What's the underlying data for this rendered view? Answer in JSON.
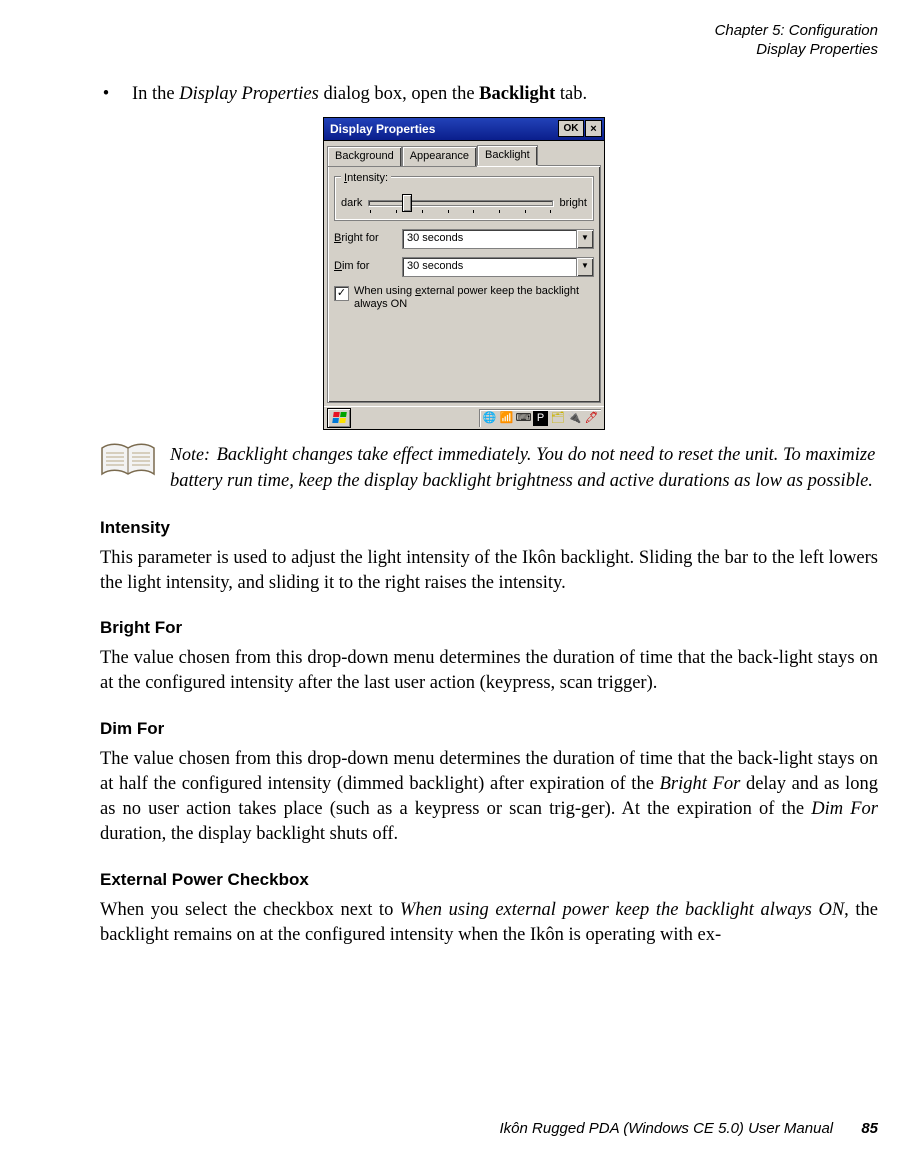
{
  "header": {
    "line1": "Chapter 5: Configuration",
    "line2": "Display Properties"
  },
  "bullet": {
    "pre": "In the ",
    "em": "Display Properties",
    "mid": " dialog box, open the ",
    "bold": "Backlight",
    "post": " tab."
  },
  "dialog": {
    "title": "Display Properties",
    "ok": "OK",
    "close": "×",
    "tabs": [
      "Background",
      "Appearance",
      "Backlight"
    ],
    "intensity_label": "Intensity:",
    "intensity_accel": "I",
    "dark": "dark",
    "bright": "bright",
    "bright_for_label": "Bright for",
    "bright_for_accel": "B",
    "dim_for_label": "Dim for",
    "dim_for_accel": "D",
    "bright_for_value": "30 seconds",
    "dim_for_value": "30 seconds",
    "check_label": "When using external power keep the backlight always ON",
    "check_accel": "e"
  },
  "note": {
    "label": "Note:",
    "text": "Backlight changes take effect immediately. You do not need to reset the unit. To maximize battery run time, keep the display backlight brightness and active durations as low as possible."
  },
  "sections": {
    "intensity": {
      "title": "Intensity",
      "body": "This parameter is used to adjust the light intensity of the Ikôn backlight. Sliding the bar to the left lowers the light intensity, and sliding it to the right raises the intensity."
    },
    "bright_for": {
      "title": "Bright For",
      "body": "The value chosen from this drop-down menu determines the duration of time that the back-light stays on at the configured intensity after the last user action (keypress, scan trigger)."
    },
    "dim_for": {
      "title": "Dim For",
      "body_pre": "The value chosen from this drop-down menu determines the duration of time that the back-light stays on at half the configured intensity (dimmed backlight) after expiration of the ",
      "em1": "Bright For",
      "body_mid": " delay and as long as no user action takes place (such as a keypress or scan trig-ger). At the expiration of the ",
      "em2": "Dim For",
      "body_post": " duration, the display backlight shuts off."
    },
    "extpower": {
      "title": "External Power Checkbox",
      "body_pre": "When you select the checkbox next to ",
      "em": "When using external power keep the backlight always ON",
      "body_post": ", the backlight remains on at the configured intensity when the Ikôn is operating with ex-"
    }
  },
  "footer": {
    "title": "Ikôn Rugged PDA (Windows CE 5.0) User Manual",
    "page": "85"
  }
}
